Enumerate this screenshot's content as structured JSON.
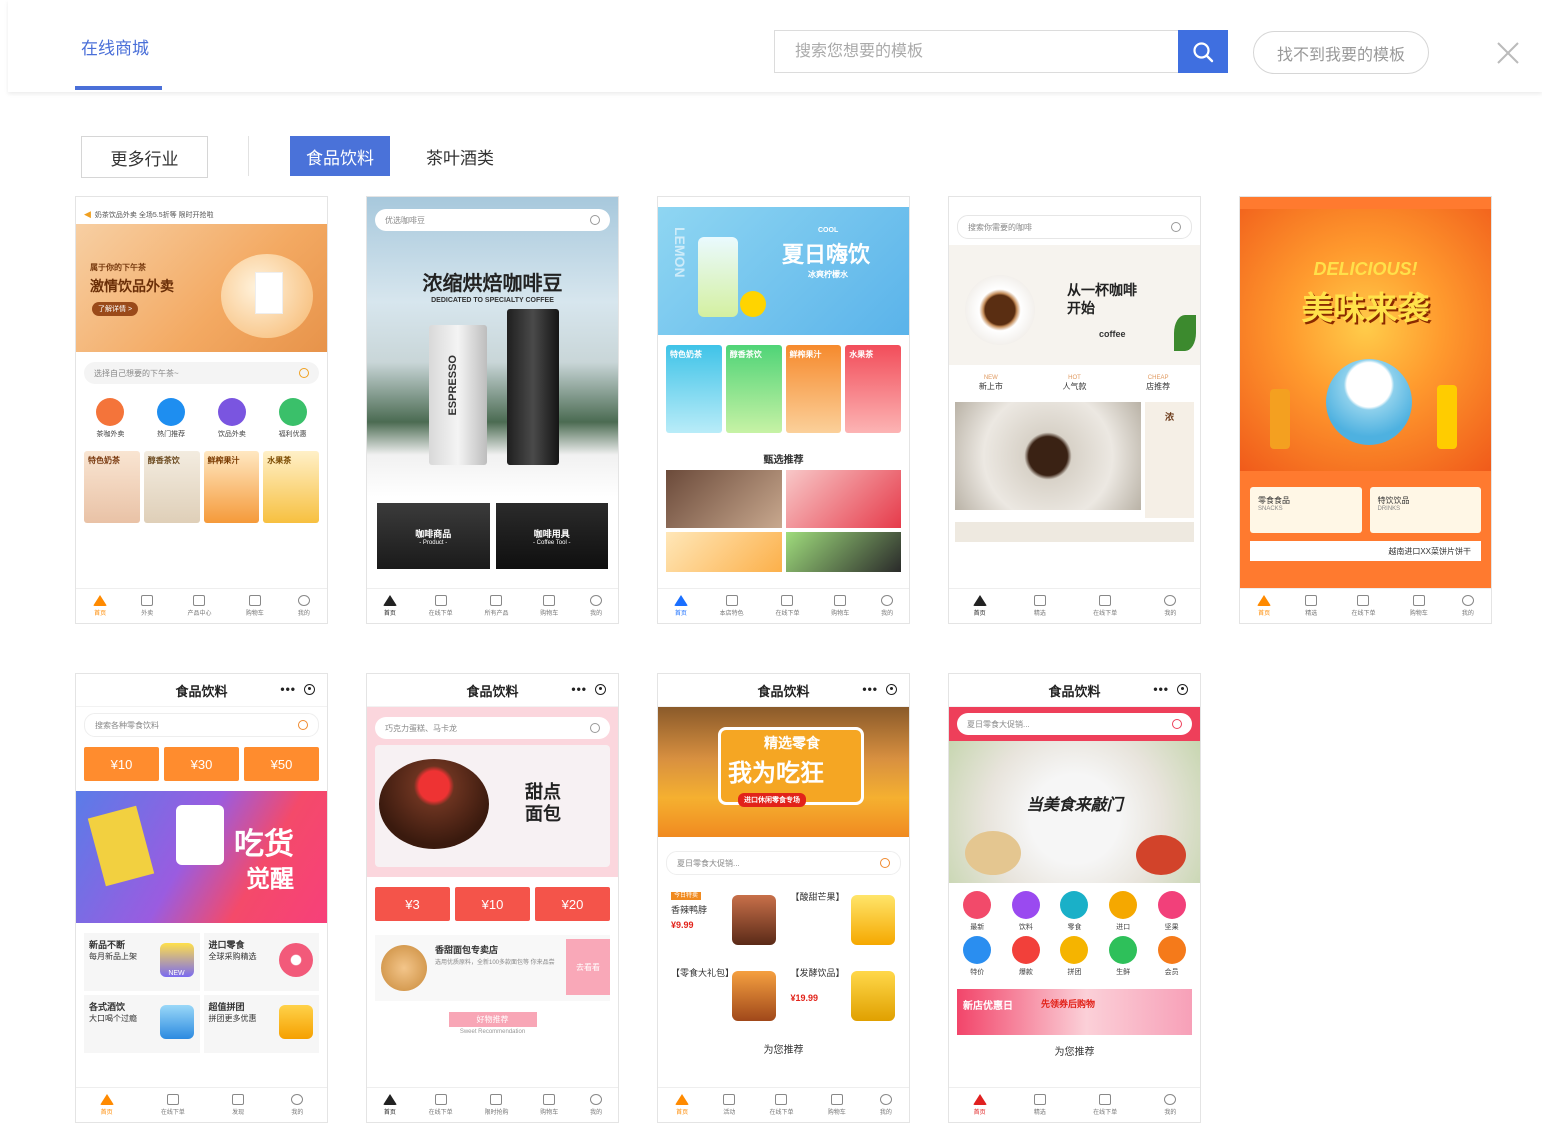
{
  "header": {
    "tab_active": "在线商城",
    "search_placeholder": "搜索您想要的模板",
    "cant_find_label": "找不到我要的模板"
  },
  "filters": {
    "more_label": "更多行业",
    "active_category": "食品饮料",
    "category_2": "茶叶酒类"
  },
  "icons": {
    "search": "search-icon",
    "close": "close-icon"
  },
  "colors": {
    "accent": "#4a6fd8",
    "search_button": "#3f6fe0"
  },
  "templates": {
    "t1": {
      "notice": "奶茶饮品外卖 全场5.5折等 限时开抢啦",
      "banner_sub": "属于你的下午茶",
      "banner_title": "激情饮品外卖",
      "banner_btn": "了解详情 >",
      "search_hint": "选择自己想要的下午茶~",
      "icons": [
        "茶咖外卖",
        "热门推荐",
        "饮品外卖",
        "福利优惠"
      ],
      "tiles": [
        "特色奶茶",
        "醇香茶饮",
        "鲜榨果汁",
        "水果茶"
      ],
      "tabbar": [
        "首页",
        "外卖",
        "产品中心",
        "购物车",
        "我的"
      ]
    },
    "t2": {
      "search_hint": "优选咖啡豆",
      "banner_title": "浓缩烘焙咖啡豆",
      "banner_sub": "DEDICATED TO SPECIALTY COFFEE",
      "bag_text": "ESPRESSO",
      "tile1": "咖啡商品",
      "tile1_sub": "- Product -",
      "tile2": "咖啡用具",
      "tile2_sub": "- Coffee Tool -",
      "tabbar": [
        "首页",
        "在线下单",
        "所有产品",
        "购物车",
        "我的"
      ]
    },
    "t3": {
      "banner_small": "COOL",
      "banner_title": "夏日嗨饮",
      "banner_sub": "冰爽柠檬水",
      "side_text": "LEMON",
      "tiles": [
        "特色奶茶",
        "醇香茶饮",
        "鲜榨果汁",
        "水果茶"
      ],
      "section": "甄选推荐",
      "tabbar": [
        "首页",
        "本店特色",
        "在线下单",
        "购物车",
        "我的"
      ]
    },
    "t4": {
      "search_hint": "搜索你需要的咖啡",
      "banner_title": "从一杯咖啡开始",
      "banner_sub": "coffee",
      "tags": [
        {
          "en": "NEW",
          "cn": "新上市"
        },
        {
          "en": "HOT",
          "cn": "人气款"
        },
        {
          "en": "CHEAP",
          "cn": "店推荐"
        }
      ],
      "side_text": "浓",
      "tabbar": [
        "首页",
        "精选",
        "在线下单",
        "我的"
      ]
    },
    "t5": {
      "banner_en": "DELICIOUS!",
      "banner_title": "美味来袭",
      "box1": "零食食品",
      "box1_en": "SNACKS",
      "box2": "特饮饮品",
      "box2_en": "DRINKS",
      "strip": "越南进口XX菜饼片饼干",
      "tabbar": [
        "首页",
        "精选",
        "在线下单",
        "购物车",
        "我的"
      ]
    },
    "t6": {
      "title": "食品饮料",
      "search_hint": "搜索各种零食饮料",
      "coupons": [
        "¥10",
        "¥30",
        "¥50"
      ],
      "banner_title": "吃货",
      "banner_title2": "觉醒",
      "items": [
        {
          "title": "新品不断",
          "sub": "每月新品上架"
        },
        {
          "title": "进口零食",
          "sub": "全球采购精选"
        },
        {
          "title": "各式酒饮",
          "sub": "大口喝个过瘾"
        },
        {
          "title": "超值拼团",
          "sub": "拼团更多优惠"
        }
      ],
      "new_badge": "NEW",
      "tabbar": [
        "首页",
        "在线下单",
        "发现",
        "我的"
      ]
    },
    "t7": {
      "title": "食品饮料",
      "search_hint": "巧克力蛋糕、马卡龙",
      "banner_title": "甜点面包",
      "coupons": [
        "¥3",
        "¥10",
        "¥20"
      ],
      "shop_name": "香甜面包专卖店",
      "shop_desc": "选用优质原料，全新100多款面包等 你来品尝",
      "shop_btn": "去看看",
      "rec_title": "好物推荐",
      "rec_sub": "Sweet Recommendation",
      "tabbar": [
        "首页",
        "在线下单",
        "限时抢购",
        "购物车",
        "我的"
      ]
    },
    "t8": {
      "title": "食品饮料",
      "banner_title": "精选零食",
      "banner_title2": "我为吃狂",
      "banner_sub": "进口休闲零食专场",
      "search_hint": "夏日零食大促销...",
      "products": [
        {
          "tag": "今日特卖",
          "name": "香辣鸭脖",
          "price": "¥9.99"
        },
        {
          "tag": "",
          "name": "【酸甜芒果】",
          "price": ""
        },
        {
          "tag": "",
          "name": "【零食大礼包】",
          "price": ""
        },
        {
          "tag": "",
          "name": "【发酵饮品】",
          "price": "¥19.99"
        }
      ],
      "section": "为您推荐",
      "tabbar": [
        "首页",
        "活动",
        "在线下单",
        "购物车",
        "我的"
      ]
    },
    "t9": {
      "title": "食品饮料",
      "search_hint": "夏日零食大促销...",
      "banner_title": "当美食来敲门",
      "icons_row1": [
        "最新",
        "饮料",
        "零食",
        "进口",
        "坚果"
      ],
      "icons_row2": [
        "特价",
        "爆款",
        "拼团",
        "生鲜",
        "会员"
      ],
      "promo_title": "新店优惠日",
      "promo_sub": "先领券后购物",
      "section": "为您推荐",
      "tabbar": [
        "首页",
        "精选",
        "在线下单",
        "我的"
      ]
    }
  }
}
